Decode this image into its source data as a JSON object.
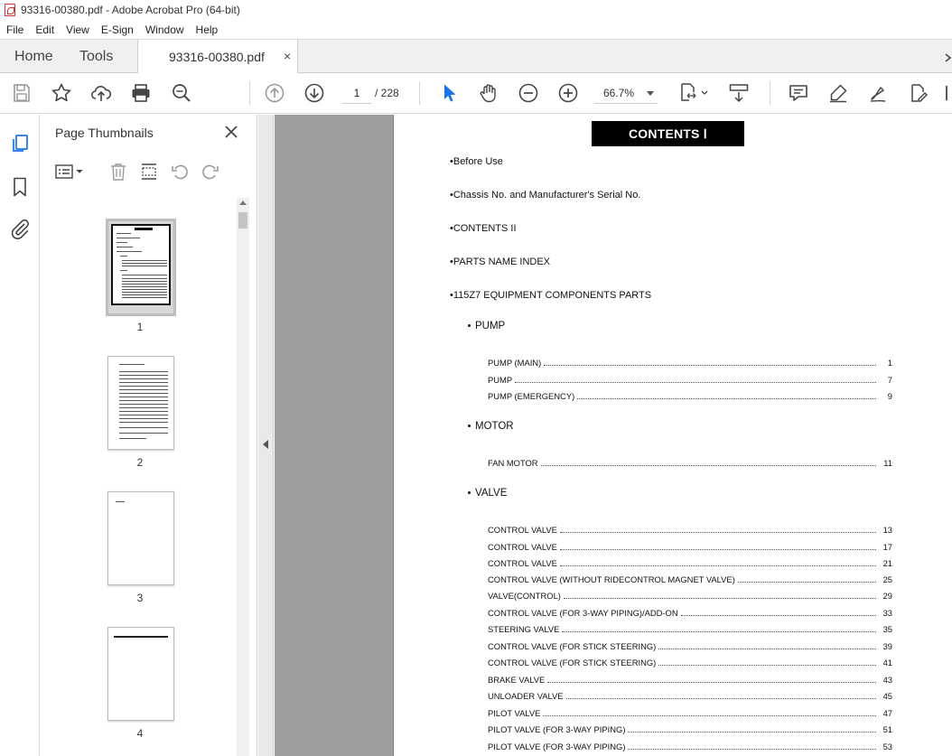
{
  "window": {
    "title": "93316-00380.pdf - Adobe Acrobat Pro (64-bit)"
  },
  "menu": [
    "File",
    "Edit",
    "View",
    "E-Sign",
    "Window",
    "Help"
  ],
  "tabs": {
    "home": "Home",
    "tools": "Tools",
    "document": "93316-00380.pdf",
    "close_glyph": "×"
  },
  "toolbar": {
    "current_page": "1",
    "page_total": "/  228",
    "zoom": "66.7%"
  },
  "thumbnails": {
    "title": "Page Thumbnails",
    "pages": [
      "1",
      "2",
      "3",
      "4"
    ]
  },
  "document": {
    "heading": "CONTENTS Ⅰ",
    "top_items": [
      "•Before Use",
      "•Chassis No. and Manufacturer's Serial No.",
      "•CONTENTS II",
      "•PARTS NAME INDEX",
      "•115Z7 EQUIPMENT COMPONENTS PARTS"
    ],
    "sections": [
      {
        "name": "PUMP",
        "entries": [
          {
            "label": "PUMP (MAIN)",
            "page": "1"
          },
          {
            "label": "PUMP",
            "page": "7"
          },
          {
            "label": "PUMP (EMERGENCY)",
            "page": "9"
          }
        ]
      },
      {
        "name": "MOTOR",
        "entries": [
          {
            "label": "FAN MOTOR",
            "page": "11"
          }
        ]
      },
      {
        "name": "VALVE",
        "entries": [
          {
            "label": "CONTROL VALVE",
            "page": "13"
          },
          {
            "label": "CONTROL VALVE",
            "page": "17"
          },
          {
            "label": "CONTROL VALVE",
            "page": "21"
          },
          {
            "label": "CONTROL VALVE (WITHOUT RIDECONTROL MAGNET VALVE)",
            "page": "25"
          },
          {
            "label": "VALVE(CONTROL)",
            "page": "29"
          },
          {
            "label": "CONTROL VALVE (FOR 3-WAY PIPING)/ADD-ON",
            "page": "33"
          },
          {
            "label": "STEERING VALVE",
            "page": "35"
          },
          {
            "label": "CONTROL VALVE (FOR STICK STEERING)",
            "page": "39"
          },
          {
            "label": "CONTROL VALVE (FOR STICK STEERING)",
            "page": "41"
          },
          {
            "label": "BRAKE VALVE",
            "page": "43"
          },
          {
            "label": "UNLOADER VALVE",
            "page": "45"
          },
          {
            "label": "PILOT VALVE",
            "page": "47"
          },
          {
            "label": "PILOT VALVE (FOR 3-WAY PIPING)",
            "page": "51"
          },
          {
            "label": "PILOT VALVE (FOR 3-WAY PIPING)",
            "page": "53"
          }
        ]
      }
    ]
  },
  "colors": {
    "accent_blue": "#1a73e8",
    "pdf_red": "#d32f2f",
    "doc_bg": "#9e9e9e"
  }
}
